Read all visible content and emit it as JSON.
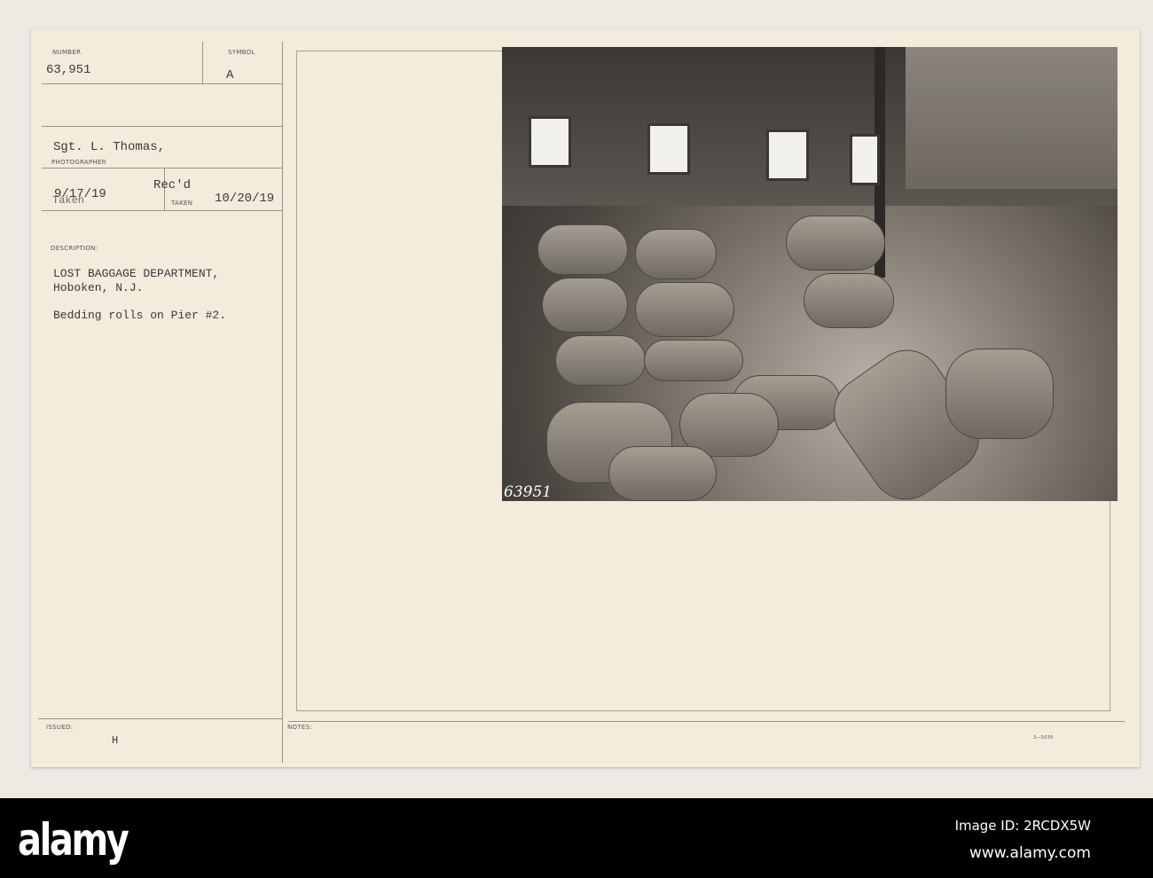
{
  "card": {
    "number_label": "NUMBER",
    "number": "63,951",
    "symbol_label": "SYMBOL",
    "symbol": "A",
    "photographer": "Sgt. L. Thomas,",
    "photographer_label": "PHOTOGRAPHER",
    "taken_date": "9/17/19",
    "taken_label": "Taken",
    "recd_label": "Rec'd",
    "recd_date": "10/20/19",
    "taken_small_label": "TAKEN",
    "description_label": "DESCRIPTION:",
    "description_line1": "LOST BAGGAGE DEPARTMENT,",
    "description_line2": "Hoboken, N.J.",
    "description_line3": "Bedding rolls on Pier #2.",
    "issued_label": "ISSUED:",
    "issued_value": "H",
    "notes_label": "NOTES:",
    "form_code": "3—5035",
    "photo_number": "63951"
  },
  "footer": {
    "logo": "alamy",
    "image_id": "Image ID: 2RCDX5W",
    "url": "www.alamy.com"
  }
}
